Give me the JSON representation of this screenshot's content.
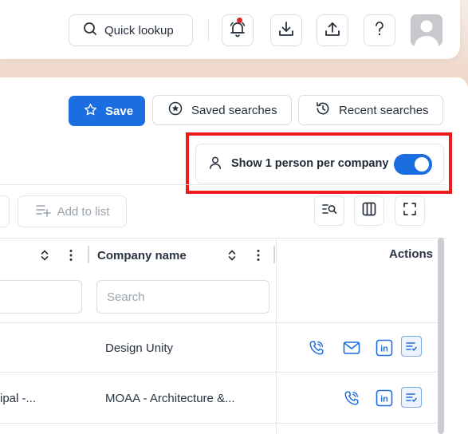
{
  "header": {
    "quick_lookup_label": "Quick lookup",
    "icons": [
      "search-icon",
      "bell-icon",
      "download-icon",
      "upload-icon",
      "help-icon",
      "avatar"
    ],
    "notification_dot_color": "#e0262b"
  },
  "toolbar": {
    "save_label": "Save",
    "saved_searches_label": "Saved searches",
    "recent_searches_label": "Recent searches",
    "accent_color": "#1b6ee0"
  },
  "toggle": {
    "label": "Show 1 person per company",
    "enabled": true
  },
  "list_actions": {
    "add_to_list_label": "Add to list"
  },
  "table": {
    "columns": [
      {
        "label": "Company name",
        "search_placeholder": "Search"
      },
      {
        "label": "Actions"
      }
    ],
    "rows": [
      {
        "title_fragment": "",
        "company": "Design Unity",
        "actions": [
          "phone-icon",
          "email-icon",
          "linkedin-icon",
          "add-to-sequence-icon"
        ]
      },
      {
        "title_fragment": "ipal -...",
        "company": "MOAA - Architecture &...",
        "actions": [
          "phone-icon",
          "linkedin-icon",
          "add-to-sequence-icon"
        ]
      }
    ]
  }
}
